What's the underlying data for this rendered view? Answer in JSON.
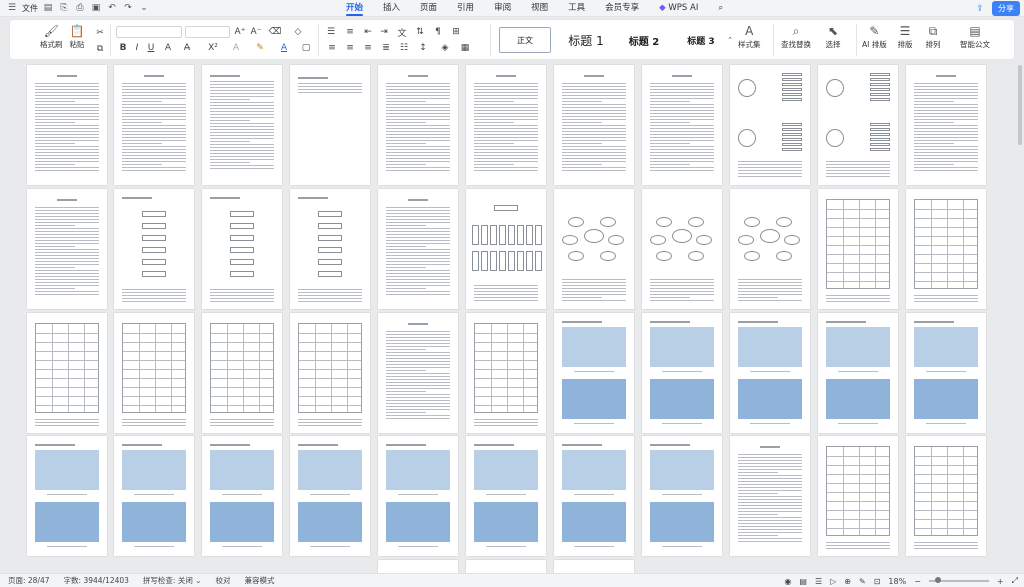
{
  "menubar": {
    "file_label": "文件",
    "tabs": [
      "开始",
      "插入",
      "页面",
      "引用",
      "审阅",
      "视图",
      "工具",
      "会员专享"
    ],
    "wps_ai": "WPS AI",
    "share_label": "分享"
  },
  "ribbon": {
    "format_painter": "格式刷",
    "paste": "粘贴",
    "styles": [
      "正文",
      "标题 1",
      "标题 2",
      "标题 3"
    ],
    "style_set": "样式集",
    "find_replace": "查找替换",
    "select": "选择",
    "ai_layout": "AI 排版",
    "layout": "排版",
    "arrange": "排列",
    "smart_doc": "智能公文"
  },
  "statusbar": {
    "page": "页面: 28/47",
    "words": "字数: 3944/12403",
    "spell": "拼写检查: 关闭",
    "proof": "校对",
    "compat": "兼容模式",
    "zoom": "18%"
  }
}
